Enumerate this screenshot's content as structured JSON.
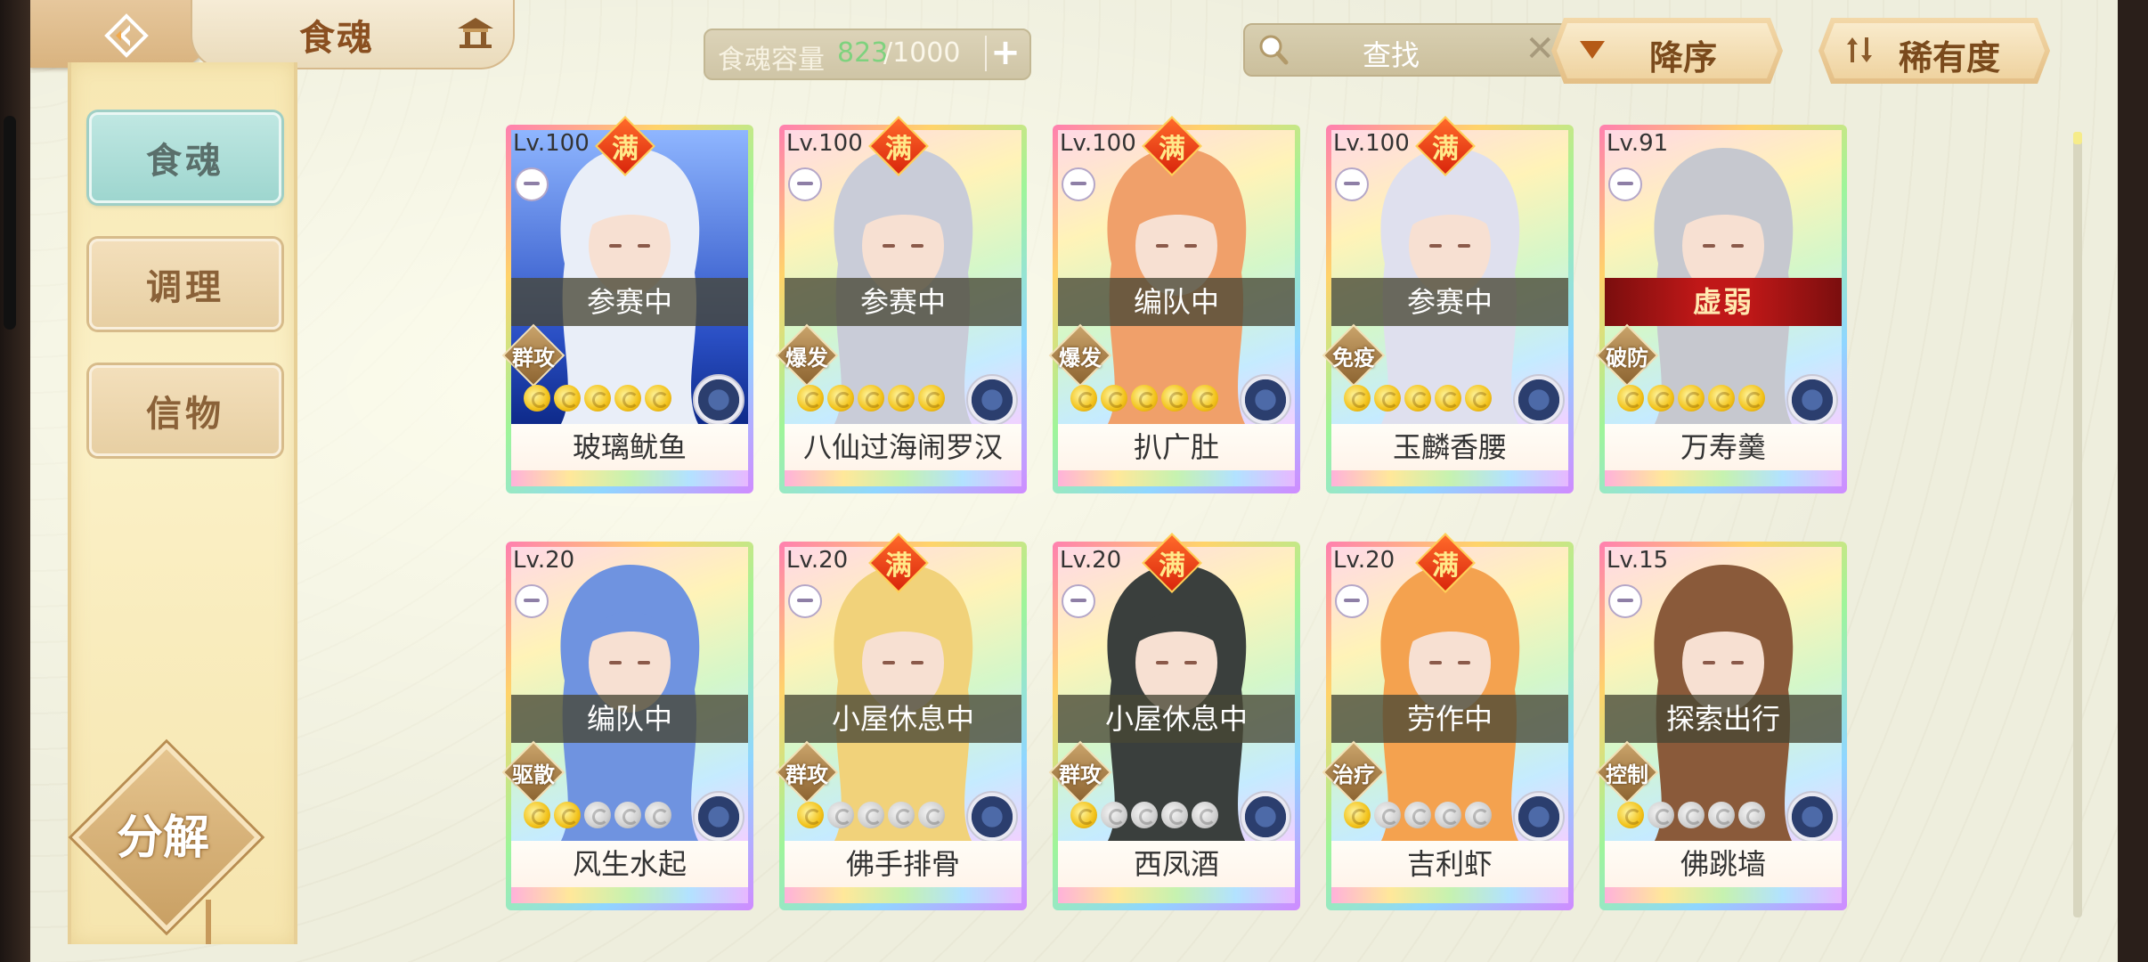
{
  "header": {
    "title": "食魂",
    "capacity": {
      "label": "食魂容量",
      "current": "823",
      "max": "/1000",
      "add": "+"
    },
    "search": {
      "placeholder": "查找",
      "clear": "✕"
    },
    "sort_order": "降序",
    "sort_by": "稀有度"
  },
  "sidebar": {
    "tabs": [
      {
        "label": "食魂",
        "active": true
      },
      {
        "label": "调理",
        "active": false
      },
      {
        "label": "信物",
        "active": false
      }
    ],
    "decompose": "分解"
  },
  "cards": [
    {
      "level": "Lv.100",
      "full": "满",
      "status": "参赛中",
      "role": "群攻",
      "stars": 5,
      "name": "玻璃鱿鱼",
      "theme": "water",
      "hair": "#e9eef8"
    },
    {
      "level": "Lv.100",
      "full": "满",
      "status": "参赛中",
      "role": "爆发",
      "stars": 5,
      "name": "八仙过海闹罗汉",
      "theme": "rainbow",
      "hair": "#c9ccd8"
    },
    {
      "level": "Lv.100",
      "full": "满",
      "status": "编队中",
      "role": "爆发",
      "stars": 5,
      "name": "扒广肚",
      "theme": "rainbow",
      "hair": "#f0a06a"
    },
    {
      "level": "Lv.100",
      "full": "满",
      "status": "参赛中",
      "role": "免疫",
      "stars": 5,
      "name": "玉麟香腰",
      "theme": "rainbow",
      "hair": "#dfe0ee"
    },
    {
      "level": "Lv.91",
      "full": "",
      "status": "虚弱",
      "role": "破防",
      "stars": 5,
      "name": "万寿羹",
      "theme": "rainbow",
      "hair": "#c6c8cf"
    },
    {
      "level": "Lv.20",
      "full": "",
      "status": "编队中",
      "role": "驱散",
      "stars": 2,
      "name": "风生水起",
      "theme": "rainbow",
      "hair": "#6f93e0"
    },
    {
      "level": "Lv.20",
      "full": "满",
      "status": "小屋休息中",
      "role": "群攻",
      "stars": 1,
      "name": "佛手排骨",
      "theme": "rainbow",
      "hair": "#f1d27a"
    },
    {
      "level": "Lv.20",
      "full": "满",
      "status": "小屋休息中",
      "role": "群攻",
      "stars": 1,
      "name": "西凤酒",
      "theme": "rainbow",
      "hair": "#3a3f3d"
    },
    {
      "level": "Lv.20",
      "full": "满",
      "status": "劳作中",
      "role": "治疗",
      "stars": 1,
      "name": "吉利虾",
      "theme": "rainbow",
      "hair": "#f4a24f"
    },
    {
      "level": "Lv.15",
      "full": "",
      "status": "探索出行",
      "role": "控制",
      "stars": 1,
      "name": "佛跳墙",
      "theme": "rainbow",
      "hair": "#8a5a3a"
    }
  ]
}
